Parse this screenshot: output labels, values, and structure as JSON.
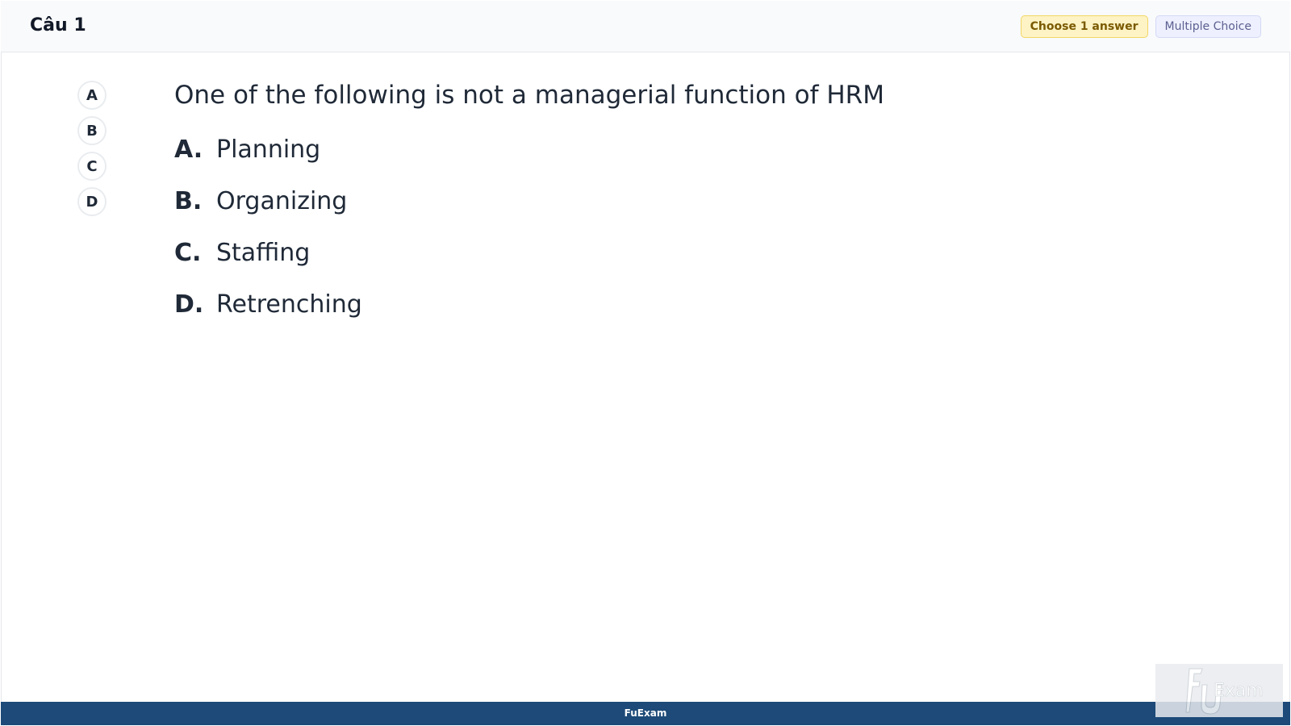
{
  "header": {
    "title": "Câu 1",
    "badge_choose": "Choose 1 answer",
    "badge_type": "Multiple Choice"
  },
  "answer_pills": [
    "A",
    "B",
    "C",
    "D"
  ],
  "question": {
    "text": "One of the following is not a managerial function of HRM",
    "options": [
      {
        "letter": "A.",
        "text": "Planning"
      },
      {
        "letter": "B.",
        "text": "Organizing"
      },
      {
        "letter": "C.",
        "text": "Staffing"
      },
      {
        "letter": "D.",
        "text": "Retrenching"
      }
    ]
  },
  "footer": {
    "label": "FuExam"
  },
  "watermark": {
    "text": "Exam"
  },
  "colors": {
    "footer_bg": "#1d4a78",
    "badge_choose_bg": "#fdf3c4",
    "badge_type_bg": "#eef0ff"
  }
}
